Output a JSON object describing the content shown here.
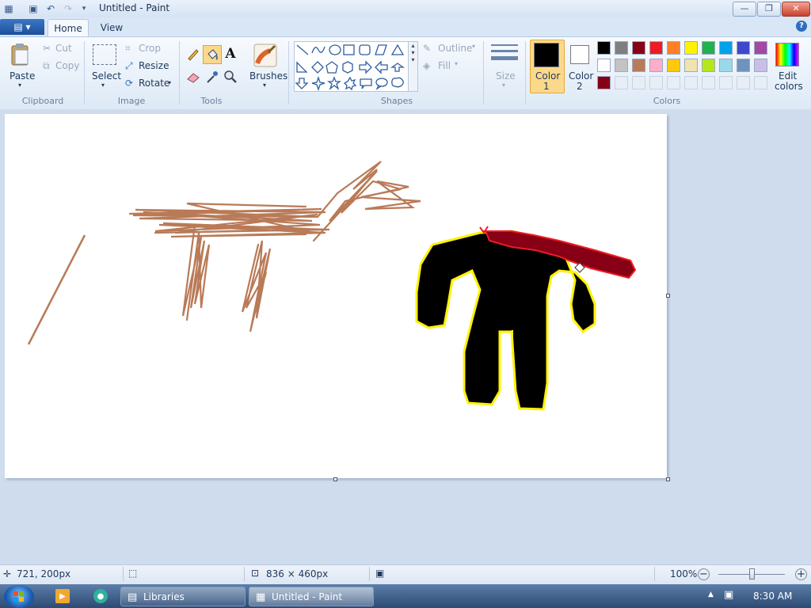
{
  "window": {
    "title": "Untitled - Paint",
    "buttons": {
      "minimize": "—",
      "maximize": "❐",
      "close": "✕"
    }
  },
  "quick_access": {
    "save_icon": "save-icon",
    "undo_icon": "undo-icon",
    "redo_icon": "redo-icon",
    "customize_icon": "dropdown-icon"
  },
  "tabs": {
    "app_menu": "▤ ▾",
    "home": "Home",
    "view": "View",
    "help": "?"
  },
  "ribbon": {
    "clipboard": {
      "label": "Clipboard",
      "paste": "Paste",
      "cut": "Cut",
      "copy": "Copy"
    },
    "image": {
      "label": "Image",
      "select": "Select",
      "crop": "Crop",
      "resize": "Resize",
      "rotate": "Rotate"
    },
    "tools": {
      "label": "Tools"
    },
    "brushes": {
      "label": "Brushes"
    },
    "shapes": {
      "label": "Shapes",
      "outline": "Outline",
      "fill": "Fill"
    },
    "size": {
      "label": "Size"
    },
    "color1": {
      "label": "Color",
      "num": "1",
      "color": "#000000"
    },
    "color2": {
      "label": "Color",
      "num": "2",
      "color": "#ffffff"
    },
    "colors": {
      "label": "Colors",
      "edit_label": "Edit",
      "edit_label2": "colors",
      "row1": [
        "#000000",
        "#7f7f7f",
        "#880015",
        "#ed1c24",
        "#ff7f27",
        "#fff200",
        "#22b14c",
        "#00a2e8",
        "#3f48cc",
        "#a349a4"
      ],
      "row2": [
        "#ffffff",
        "#c3c3c3",
        "#b97a57",
        "#ffaec9",
        "#ffc90e",
        "#efe4b0",
        "#b5e61d",
        "#99d9ea",
        "#7092be",
        "#c8bfe7"
      ],
      "row3": [
        "#880015",
        "",
        "",
        "",
        "",
        "",
        "",
        "",
        "",
        ""
      ]
    }
  },
  "drawing": {
    "brown": "#b97a57",
    "black": "#000000",
    "yellow": "#fff200",
    "red": "#880015",
    "red_outline": "#ed1c24"
  },
  "status": {
    "cursor_pos": "721, 200px",
    "canvas_size": "836 × 460px",
    "zoom": "100%",
    "zoom_level": 0.5
  },
  "taskbar": {
    "libraries": "Libraries",
    "paint": "Untitled - Paint",
    "clock": "8:30 AM"
  }
}
